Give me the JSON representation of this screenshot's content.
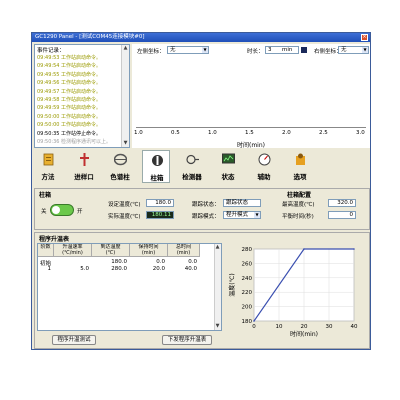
{
  "window": {
    "title": "GC1290 Panel - [测试COM45连接模块#0]",
    "close": "×"
  },
  "log": {
    "title": "事件记录：",
    "lines": [
      {
        "text": "09:49:53 工作站启动命令。",
        "tone": "yellow"
      },
      {
        "text": "09:49:54 工作站启动命令。",
        "tone": "yellow"
      },
      {
        "text": "09:49:55 工作站启动命令。",
        "tone": "yellow"
      },
      {
        "text": "09:49:56 工作站启动命令。",
        "tone": "yellow"
      },
      {
        "text": "09:49:57 工作站启动命令。",
        "tone": "yellow"
      },
      {
        "text": "09:49:58 工作站启动命令。",
        "tone": "yellow"
      },
      {
        "text": "09:49:59 工作站启动命令。",
        "tone": "yellow"
      },
      {
        "text": "09:50:00 工作站启动命令。",
        "tone": "yellow"
      },
      {
        "text": "09:50:00 工作站启动命令。",
        "tone": "yellow"
      },
      {
        "text": "09:50:35 工作站停止命令。",
        "tone": "black"
      },
      {
        "text": "09:50:36 检测程序通讯可以上。",
        "tone": "gray"
      }
    ]
  },
  "topbar": {
    "left_axis_label": "左侧坐标：",
    "left_axis_value": "无",
    "duration_label": "时长：",
    "duration_value": "3",
    "duration_unit": "min",
    "right_axis_label": "右侧坐标：",
    "right_axis_value": "无"
  },
  "top_chart": {
    "xticks": [
      "1.0",
      "0.5",
      "1.0",
      "1.5",
      "2.0",
      "2.5",
      "3.0"
    ],
    "xlabel": "时间(min)"
  },
  "toolbar": {
    "items": [
      {
        "label": "方法",
        "icon": "document-icon"
      },
      {
        "label": "进样口",
        "icon": "injector-icon"
      },
      {
        "label": "色谱柱",
        "icon": "column-icon"
      },
      {
        "label": "柱箱",
        "icon": "oven-icon",
        "selected": true
      },
      {
        "label": "检测器",
        "icon": "detector-icon"
      },
      {
        "label": "状态",
        "icon": "monitor-icon"
      },
      {
        "label": "辅助",
        "icon": "gauge-icon"
      },
      {
        "label": "选项",
        "icon": "options-icon"
      }
    ]
  },
  "oven": {
    "section_title": "柱箱",
    "switch_off": "关",
    "switch_on": "开",
    "set_temp_label": "设定温度(℃)",
    "set_temp_value": "180.0",
    "actual_temp_label": "实际温度(℃)",
    "actual_temp_value": "180.11",
    "trace_status_label": "跟踪状态：",
    "trace_status_value": "跟踪状态",
    "trace_mode_label": "跟踪模式：",
    "trace_mode_value": "程升模式",
    "config_title": "柱箱配置",
    "max_temp_label": "最高温度(℃)",
    "max_temp_value": "320.0",
    "balance_label": "平衡时间(秒)",
    "balance_value": "0"
  },
  "program": {
    "section_title": "程序升温表",
    "headers": [
      "阶数",
      "升温速率\n(℃/min)",
      "到达温度\n(℃)",
      "保持时间\n(min)",
      "总时间\n(min)"
    ],
    "rows": [
      {
        "stage": "初始",
        "rate": "",
        "temp": "180.0",
        "hold": "0.0",
        "total": "0.0"
      },
      {
        "stage": "1",
        "rate": "5.0",
        "temp": "280.0",
        "hold": "20.0",
        "total": "40.0"
      }
    ],
    "test_button": "程序升温测试",
    "download_button": "下发程序升温表"
  },
  "chart_data": {
    "type": "line",
    "x": [
      0,
      20,
      40
    ],
    "series": [
      {
        "values": [
          180,
          280,
          280
        ]
      }
    ],
    "xlabel": "时间(min)",
    "ylabel": "温度(℃)",
    "xlim": [
      0,
      40
    ],
    "ylim": [
      180,
      280
    ],
    "xticks": [
      0,
      10,
      20,
      30,
      40
    ],
    "yticks": [
      180,
      200,
      220,
      240,
      260,
      280
    ],
    "grid": true,
    "line_color": "#3a4fb0"
  }
}
